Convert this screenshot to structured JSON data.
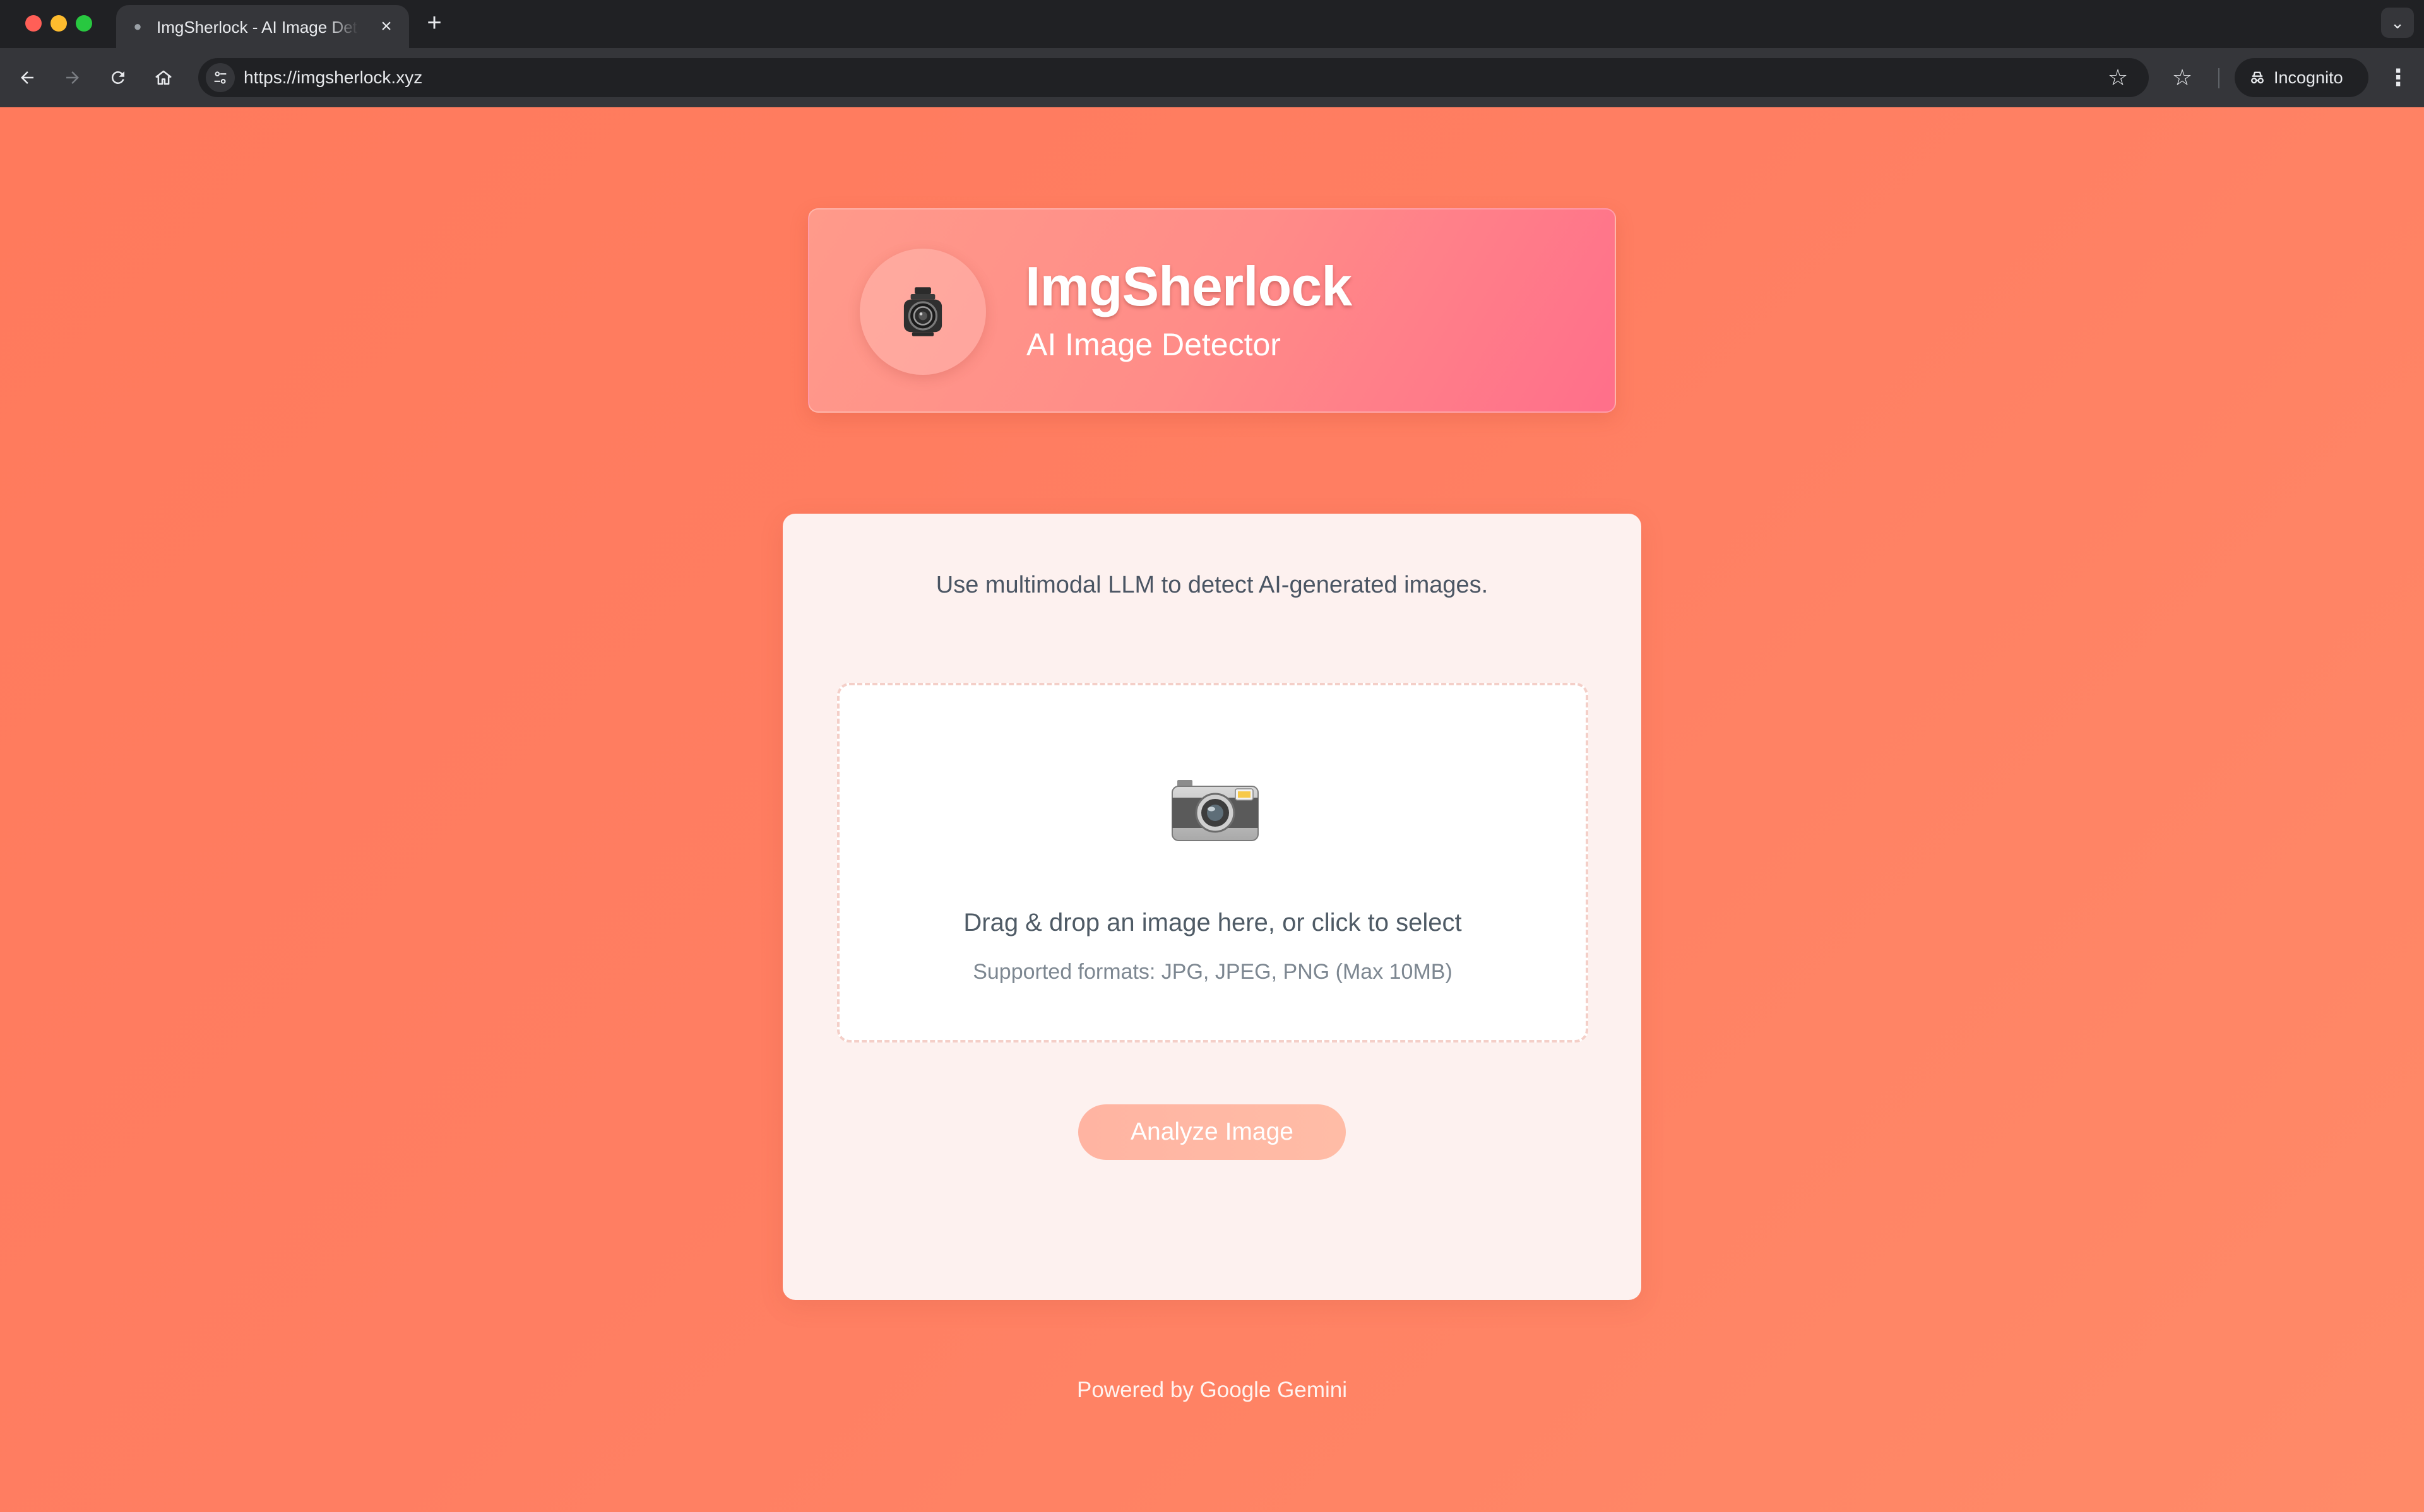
{
  "browser": {
    "tab_title": "ImgSherlock - AI Image Detector",
    "url": "https://imgsherlock.xyz",
    "incognito_label": "Incognito",
    "icons": {
      "new_tab": "plus-icon",
      "tab_close": "close-icon",
      "back": "arrow-left-icon",
      "forward": "arrow-right-icon",
      "reload": "reload-icon",
      "home": "home-icon",
      "site_info": "tune-icon",
      "bookmark": "star-icon",
      "bookmarks": "star-list-icon",
      "menu": "kebab-icon",
      "tab_search": "chevron-down-icon"
    }
  },
  "header": {
    "title": "ImgSherlock",
    "subtitle": "AI Image Detector",
    "logo_icon": "vintage-camera-icon"
  },
  "main": {
    "intro": "Use multimodal LLM to detect AI-generated images.",
    "dropzone": {
      "icon": "camera-icon",
      "title": "Drag & drop an image here, or click to select",
      "formats": "Supported formats: JPG, JPEG, PNG (Max 10MB)"
    },
    "analyze_label": "Analyze Image"
  },
  "footer": {
    "text": "Powered by Google Gemini"
  },
  "colors": {
    "background_gradient_start": "#ff7a5c",
    "background_gradient_end": "#ff8a68",
    "card_background": "#fdf1ef",
    "button_disabled": "#ffb4a2",
    "chrome_dark": "#202124",
    "chrome_toolbar": "#35363a"
  }
}
